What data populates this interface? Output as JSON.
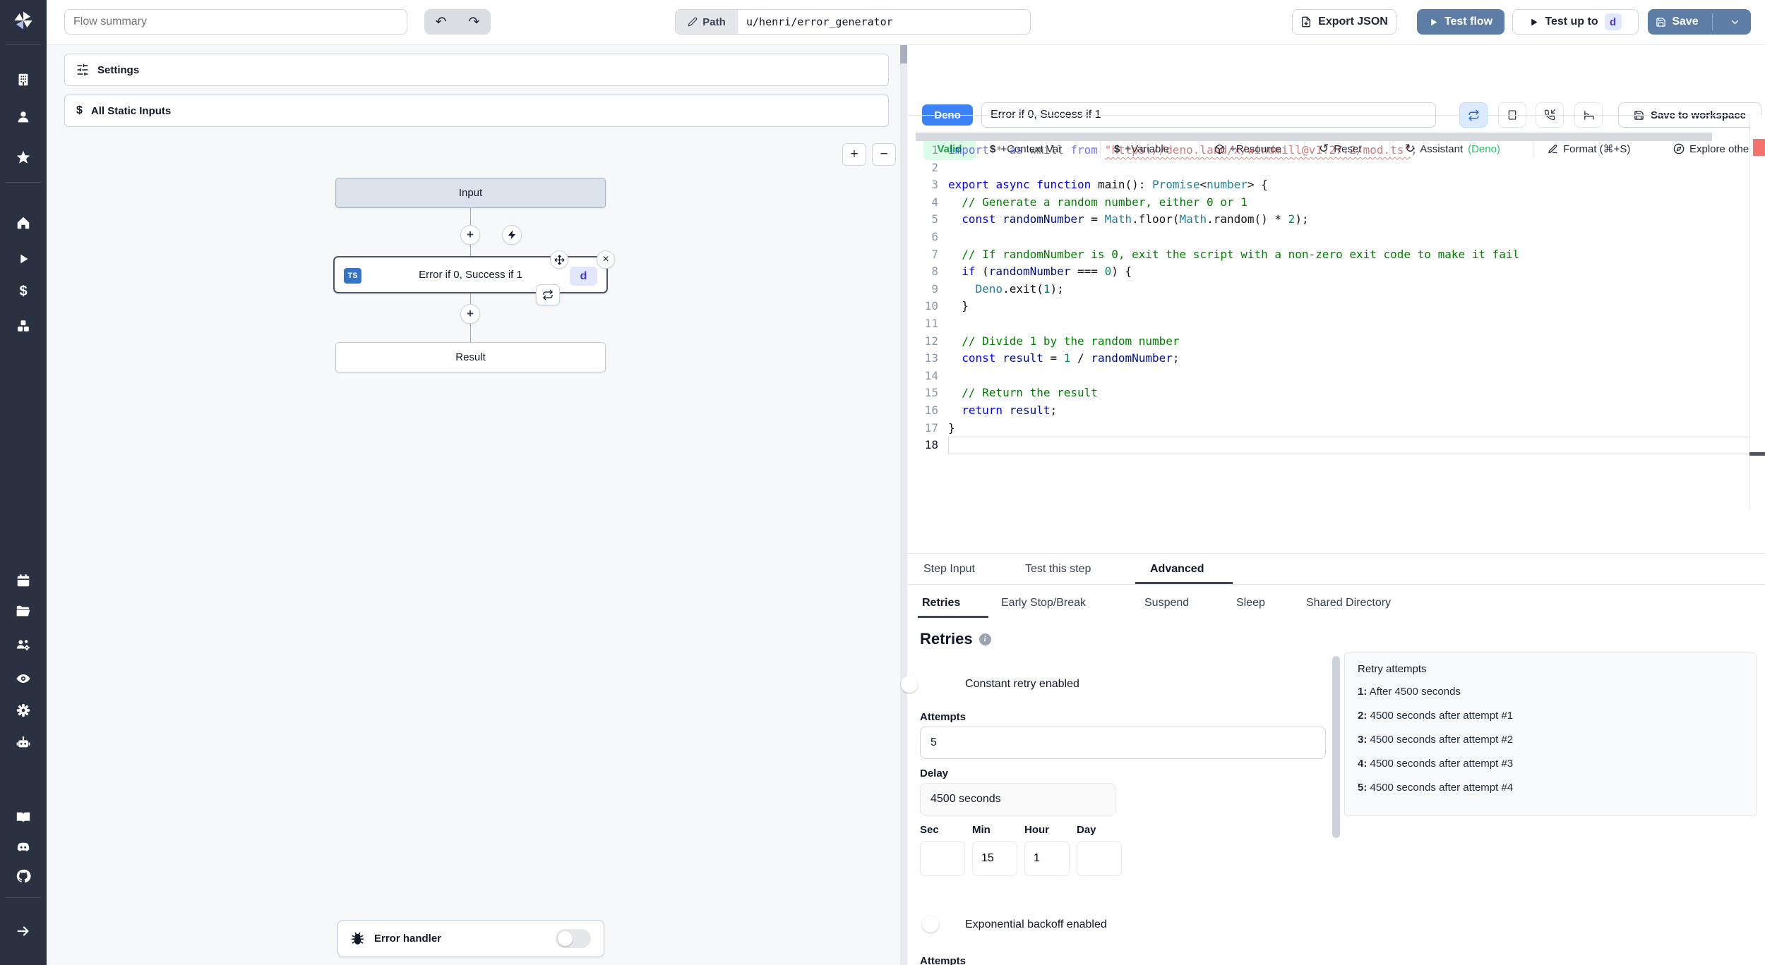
{
  "topbar": {
    "flow_summary_placeholder": "Flow summary",
    "undo_icon": "↶",
    "redo_icon": "↷",
    "path_label": "Path",
    "path_value": "u/henri/error_generator",
    "export_json": "Export JSON",
    "test_flow": "Test flow",
    "test_up_to": "Test up to",
    "test_up_to_badge": "d",
    "save": "Save"
  },
  "sidebar": {
    "icons": [
      "windmill-logo",
      "workspace",
      "user",
      "favorites",
      "home",
      "runs",
      "variables",
      "resources",
      "schedules",
      "folders",
      "groups",
      "audit-logs",
      "settings",
      "workers",
      "docs",
      "discord",
      "github",
      "collapse"
    ]
  },
  "flow_panel": {
    "settings_label": "Settings",
    "static_inputs_label": "All Static Inputs",
    "zoom_in": "+",
    "zoom_out": "−",
    "error_handler_label": "Error handler"
  },
  "graph": {
    "input_label": "Input",
    "step_lang_badge": "TS",
    "step_label": "Error if 0, Success if 1",
    "step_id_badge": "d",
    "result_label": "Result",
    "close_icon": "×"
  },
  "editor": {
    "lang_badge": "Deno",
    "step_name": "Error if 0, Success if 1",
    "save_to_workspace": "Save to workspace",
    "toolbar": {
      "valid": "Valid",
      "context_var": "+Context Var",
      "variable": "+Variable",
      "resource": "+Resource",
      "reset": "Reset",
      "assistant": "Assistant",
      "assistant_lang": "(Deno)",
      "format": "Format (⌘+S)",
      "explore": "Explore other s",
      "dollar_icon": "$",
      "reset_icon": "↺",
      "assistant_icon": "↻"
    },
    "code": {
      "lines": [
        {
          "n": 1,
          "fade": true,
          "tokens": [
            [
              "k",
              "import"
            ],
            [
              "p",
              " * "
            ],
            [
              "k",
              "as"
            ],
            [
              "p",
              " wmill "
            ],
            [
              "k",
              "from"
            ],
            [
              "p",
              " "
            ],
            [
              "su",
              "\"https://deno.land/x/windmill@v1.27.2/mod.ts\""
            ],
            [
              "p",
              ";"
            ]
          ]
        },
        {
          "n": 2,
          "tokens": []
        },
        {
          "n": 3,
          "tokens": [
            [
              "k",
              "export"
            ],
            [
              "p",
              " "
            ],
            [
              "k",
              "async"
            ],
            [
              "p",
              " "
            ],
            [
              "k",
              "function"
            ],
            [
              "p",
              " main(): "
            ],
            [
              "t",
              "Promise"
            ],
            [
              "p",
              "<"
            ],
            [
              "t",
              "number"
            ],
            [
              "p",
              "> {"
            ]
          ]
        },
        {
          "n": 4,
          "tokens": [
            [
              "c",
              "  // Generate a random number, either 0 or 1"
            ]
          ]
        },
        {
          "n": 5,
          "tokens": [
            [
              "p",
              "  "
            ],
            [
              "k",
              "const"
            ],
            [
              "p",
              " "
            ],
            [
              "v",
              "randomNumber"
            ],
            [
              "p",
              " = "
            ],
            [
              "t",
              "Math"
            ],
            [
              "p",
              ".floor("
            ],
            [
              "t",
              "Math"
            ],
            [
              "p",
              ".random() * "
            ],
            [
              "n",
              "2"
            ],
            [
              "p",
              ");"
            ]
          ]
        },
        {
          "n": 6,
          "tokens": []
        },
        {
          "n": 7,
          "tokens": [
            [
              "c",
              "  // If randomNumber is 0, exit the script with a non-zero exit code to make it fail"
            ]
          ]
        },
        {
          "n": 8,
          "tokens": [
            [
              "p",
              "  "
            ],
            [
              "k",
              "if"
            ],
            [
              "p",
              " ("
            ],
            [
              "v",
              "randomNumber"
            ],
            [
              "p",
              " === "
            ],
            [
              "n",
              "0"
            ],
            [
              "p",
              ") {"
            ]
          ]
        },
        {
          "n": 9,
          "tokens": [
            [
              "p",
              "    "
            ],
            [
              "t",
              "Deno"
            ],
            [
              "p",
              ".exit("
            ],
            [
              "n",
              "1"
            ],
            [
              "p",
              ");"
            ]
          ]
        },
        {
          "n": 10,
          "tokens": [
            [
              "p",
              "  }"
            ]
          ]
        },
        {
          "n": 11,
          "tokens": []
        },
        {
          "n": 12,
          "tokens": [
            [
              "c",
              "  // Divide 1 by the random number"
            ]
          ]
        },
        {
          "n": 13,
          "tokens": [
            [
              "p",
              "  "
            ],
            [
              "k",
              "const"
            ],
            [
              "p",
              " "
            ],
            [
              "v",
              "result"
            ],
            [
              "p",
              " = "
            ],
            [
              "n",
              "1"
            ],
            [
              "p",
              " / "
            ],
            [
              "v",
              "randomNumber"
            ],
            [
              "p",
              ";"
            ]
          ]
        },
        {
          "n": 14,
          "tokens": []
        },
        {
          "n": 15,
          "tokens": [
            [
              "c",
              "  // Return the result"
            ]
          ]
        },
        {
          "n": 16,
          "tokens": [
            [
              "p",
              "  "
            ],
            [
              "k",
              "return"
            ],
            [
              "p",
              " "
            ],
            [
              "v",
              "result"
            ],
            [
              "p",
              ";"
            ]
          ]
        },
        {
          "n": 17,
          "tokens": [
            [
              "p",
              "}"
            ]
          ]
        },
        {
          "n": 18,
          "current": true,
          "tokens": []
        }
      ]
    }
  },
  "tabs": {
    "main": [
      {
        "label": "Step Input",
        "active": false
      },
      {
        "label": "Test this step",
        "active": false
      },
      {
        "label": "Advanced",
        "active": true
      }
    ],
    "sub": [
      {
        "label": "Retries",
        "active": true
      },
      {
        "label": "Early Stop/Break",
        "active": false
      },
      {
        "label": "Suspend",
        "active": false
      },
      {
        "label": "Sleep",
        "active": false
      },
      {
        "label": "Shared Directory",
        "active": false
      }
    ]
  },
  "retries": {
    "heading": "Retries",
    "constant_label": "Constant retry enabled",
    "attempts_label": "Attempts",
    "attempts_value": "5",
    "delay_label": "Delay",
    "delay_value": "4500 seconds",
    "time_fields": [
      {
        "label": "Sec",
        "value": ""
      },
      {
        "label": "Min",
        "value": "15"
      },
      {
        "label": "Hour",
        "value": "1"
      },
      {
        "label": "Day",
        "value": ""
      }
    ],
    "exponential_label": "Exponential backoff enabled",
    "next_section_label": "Attempts"
  },
  "retry_preview": {
    "title": "Retry attempts",
    "items": [
      {
        "n": "1:",
        "text": "After 4500 seconds"
      },
      {
        "n": "2:",
        "text": "4500 seconds after attempt #1"
      },
      {
        "n": "3:",
        "text": "4500 seconds after attempt #2"
      },
      {
        "n": "4:",
        "text": "4500 seconds after attempt #3"
      },
      {
        "n": "5:",
        "text": "4500 seconds after attempt #4"
      }
    ]
  },
  "colors": {
    "accent_blue": "#5e7da6",
    "deno_blue": "#3b82f6",
    "toggle_on": "#2563eb",
    "valid_bg": "#dcfce7",
    "valid_text": "#16a34a",
    "badge_bg": "#e0e7ff",
    "badge_text": "#4338ca",
    "ts_badge": "#3674c5",
    "error_marker": "#f4726b",
    "assistant_green": "#22c55e",
    "sidebar_bg": "#2a3140"
  }
}
